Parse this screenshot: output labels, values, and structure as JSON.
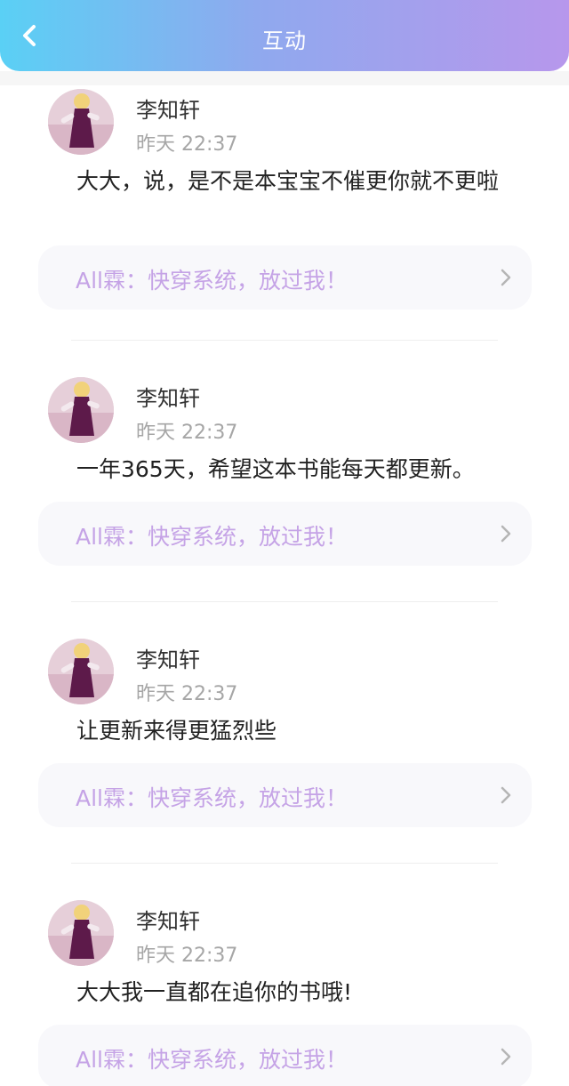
{
  "header": {
    "title": "互动"
  },
  "comments": [
    {
      "user": "李知轩",
      "time": "昨天 22:37",
      "text": "大大，说，是不是本宝宝不催更你就不更啦",
      "book_link": "All霖：快穿系统，放过我！"
    },
    {
      "user": "李知轩",
      "time": "昨天 22:37",
      "text": "一年365天，希望这本书能每天都更新。",
      "book_link": "All霖：快穿系统，放过我！"
    },
    {
      "user": "李知轩",
      "time": "昨天 22:37",
      "text": "让更新来得更猛烈些",
      "book_link": "All霖：快穿系统，放过我！"
    },
    {
      "user": "李知轩",
      "time": "昨天 22:37",
      "text": "大大我一直都在追你的书哦!",
      "book_link": "All霖：快穿系统，放过我！"
    }
  ],
  "colors": {
    "header_gradient_start": "#5ad0f5",
    "header_gradient_end": "#b797ec",
    "book_link_text": "#c5a3e6",
    "time_text": "#a6a6a6"
  },
  "icons": {
    "back": "chevron-left-icon",
    "row_arrow": "chevron-right-icon"
  }
}
